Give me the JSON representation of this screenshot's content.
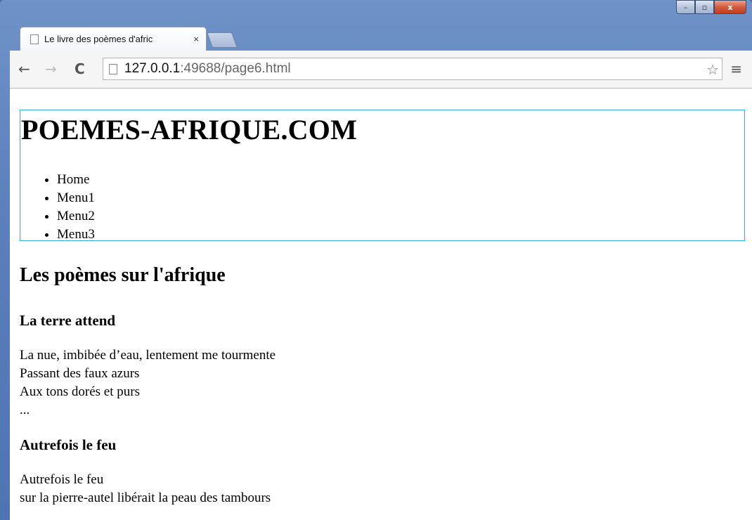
{
  "browser": {
    "tab_title": "Le livre des poèmes d'afric",
    "url_host": "127.0.0.1",
    "url_rest": ":49688/page6.html"
  },
  "window_controls": {
    "minimize": "–",
    "maximize": "▫",
    "close": "x"
  },
  "icons": {
    "back": "←",
    "forward": "→",
    "reload": "C",
    "star": "☆",
    "menu": "≡",
    "tab_close": "×"
  },
  "page": {
    "site_title": "POEMES-AFRIQUE.COM",
    "nav": [
      "Home",
      "Menu1",
      "Menu2",
      "Menu3"
    ],
    "heading": "Les poèmes sur l'afrique",
    "poems": [
      {
        "title": "La terre attend",
        "lines": [
          "La nue, imbibée d’eau, lentement me tourmente",
          "Passant des faux azurs",
          "Aux tons dorés et purs",
          "..."
        ]
      },
      {
        "title": "Autrefois le feu",
        "lines": [
          "Autrefois le feu",
          "sur la pierre-autel libérait la peau des tambours"
        ]
      }
    ]
  }
}
